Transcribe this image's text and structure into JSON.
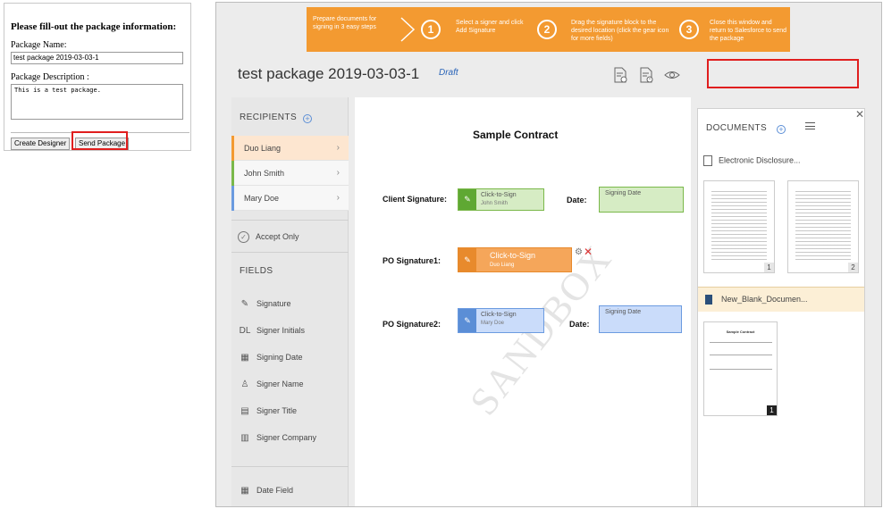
{
  "form": {
    "title": "Please fill-out the package information:",
    "name_label": "Package Name:",
    "name_value": "test package 2019-03-03-1",
    "desc_label": "Package Description :",
    "desc_value": "This is a test package.",
    "create_designer": "Create Designer",
    "send_package": "Send Package"
  },
  "banner": {
    "intro": "Prepare documents for signing in 3 easy steps",
    "steps": [
      {
        "num": "1",
        "text": "Select a signer and click Add Signature"
      },
      {
        "num": "2",
        "text": "Drag the signature block to the desired location (click the gear icon for more fields)"
      },
      {
        "num": "3",
        "text": "Close this window and return to Salesforce to send the package"
      }
    ]
  },
  "package": {
    "title": "test package 2019-03-03-1",
    "status": "Draft"
  },
  "recipients": {
    "heading": "RECIPIENTS",
    "items": [
      {
        "name": "Duo Liang",
        "color": "#f39a31"
      },
      {
        "name": "John Smith",
        "color": "#7ab84a"
      },
      {
        "name": "Mary Doe",
        "color": "#6b9be0"
      }
    ],
    "accept_only": "Accept Only"
  },
  "fields": {
    "heading": "FIELDS",
    "items": [
      {
        "icon": "pen-icon",
        "glyph": "✎",
        "label": "Signature"
      },
      {
        "icon": "initials-icon",
        "glyph": "DL",
        "label": "Signer Initials"
      },
      {
        "icon": "calendar-icon",
        "glyph": "▦",
        "label": "Signing Date"
      },
      {
        "icon": "person-icon",
        "glyph": "♙",
        "label": "Signer Name"
      },
      {
        "icon": "id-card-icon",
        "glyph": "▤",
        "label": "Signer Title"
      },
      {
        "icon": "building-icon",
        "glyph": "▥",
        "label": "Signer Company"
      }
    ],
    "date_field": "Date Field"
  },
  "document": {
    "title": "Sample Contract",
    "client_label": "Client Signature:",
    "po1_label": "PO Signature1:",
    "po2_label": "PO Signature2:",
    "date_label": "Date:",
    "sig_client_main": "Click-to-Sign",
    "sig_client_sub": "John Smith",
    "sig_po1_main": "Click-to-Sign",
    "sig_po1_sub": "Duo Liang",
    "sig_po2_main": "Click-to-Sign",
    "sig_po2_sub": "Mary Doe",
    "date_block": "Signing Date",
    "watermark": "SANDBOX"
  },
  "documents": {
    "heading": "DOCUMENTS",
    "doc1": "Electronic Disclosure...",
    "doc2": "New_Blank_Documen...",
    "page1": "1",
    "page2": "2",
    "page3": "1",
    "thumb_title": "Sample Contract"
  }
}
